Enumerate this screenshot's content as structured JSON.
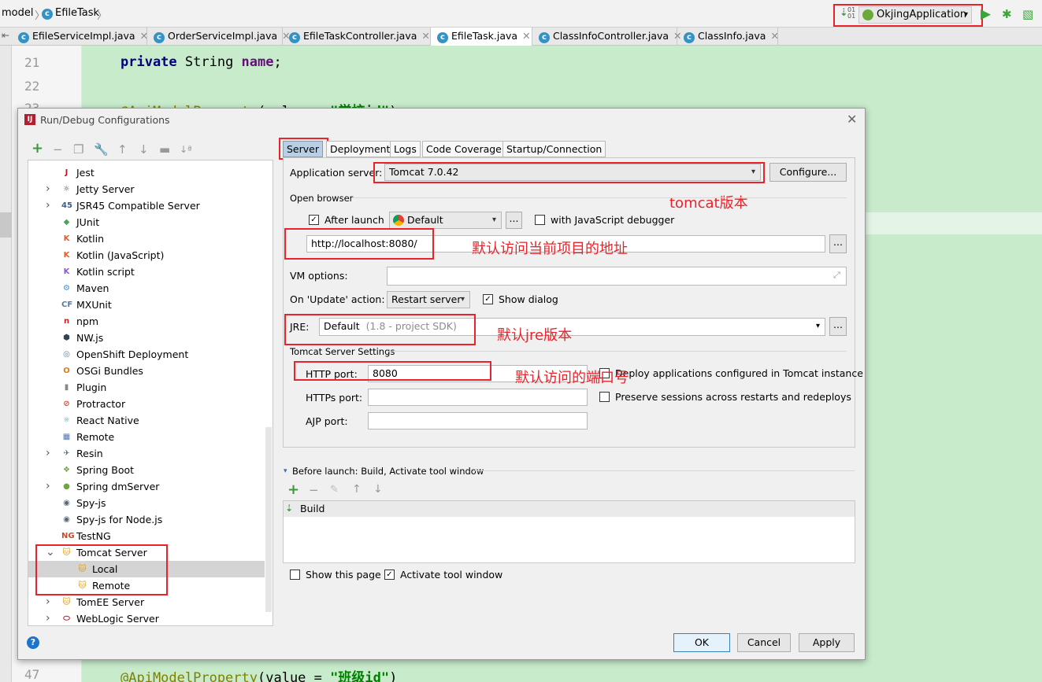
{
  "breadcrumb": {
    "segment1": "model",
    "segment2": "EfileTask",
    "sep": "〉"
  },
  "run_config": {
    "label": "OkjingApplication"
  },
  "tabs": [
    {
      "label": "EfileServiceImpl.java"
    },
    {
      "label": "OrderServiceImpl.java"
    },
    {
      "label": "EfileTaskController.java"
    },
    {
      "label": "EfileTask.java"
    },
    {
      "label": "ClassInfoController.java"
    },
    {
      "label": "ClassInfo.java"
    }
  ],
  "editor": {
    "line21": "21",
    "line22": "22",
    "line23": "23",
    "line47": "47",
    "code21_kw": "private",
    "code21_type": " String ",
    "code21_field": "name",
    "code21_end": ";",
    "code23_ann": "@ApiModelProperty",
    "code23_mid": "(value = ",
    "code23_str": "\"学校id\"",
    "code23_end": ")",
    "code47_ann": "@ApiModelProperty",
    "code47_mid": "(value = ",
    "code47_str": "\"班级id\"",
    "code47_end": ")"
  },
  "dialog": {
    "title": "Run/Debug Configurations",
    "tree": [
      {
        "label": "Jest",
        "arrow": "",
        "indent": 0,
        "icon": "J",
        "color": "#c21325"
      },
      {
        "label": "Jetty Server",
        "arrow": ">",
        "indent": 0,
        "icon": "☼",
        "color": "#555555"
      },
      {
        "label": "JSR45 Compatible Server",
        "arrow": ">",
        "indent": 0,
        "icon": "45",
        "color": "#3a5f8a"
      },
      {
        "label": "JUnit",
        "arrow": "",
        "indent": 0,
        "icon": "◆",
        "color": "#4aa35a"
      },
      {
        "label": "Kotlin",
        "arrow": "",
        "indent": 0,
        "icon": "K",
        "color": "#e05e2e"
      },
      {
        "label": "Kotlin (JavaScript)",
        "arrow": "",
        "indent": 0,
        "icon": "K",
        "color": "#e05e2e"
      },
      {
        "label": "Kotlin script",
        "arrow": "",
        "indent": 0,
        "icon": "K",
        "color": "#8c5ad6"
      },
      {
        "label": "Maven",
        "arrow": "",
        "indent": 0,
        "icon": "⚙",
        "color": "#4a90c8"
      },
      {
        "label": "MXUnit",
        "arrow": "",
        "indent": 0,
        "icon": "CF",
        "color": "#5a7a9a"
      },
      {
        "label": "npm",
        "arrow": "",
        "indent": 0,
        "icon": "n",
        "color": "#c12127"
      },
      {
        "label": "NW.js",
        "arrow": "",
        "indent": 0,
        "icon": "⬢",
        "color": "#334455"
      },
      {
        "label": "OpenShift Deployment",
        "arrow": "",
        "indent": 0,
        "icon": "◎",
        "color": "#3a8fc7"
      },
      {
        "label": "OSGi Bundles",
        "arrow": "",
        "indent": 0,
        "icon": "O",
        "color": "#e07b1a"
      },
      {
        "label": "Plugin",
        "arrow": "",
        "indent": 0,
        "icon": "▮",
        "color": "#888888"
      },
      {
        "label": "Protractor",
        "arrow": "",
        "indent": 0,
        "icon": "⊘",
        "color": "#d24a3a"
      },
      {
        "label": "React Native",
        "arrow": "",
        "indent": 0,
        "icon": "⚛",
        "color": "#3aa8d8"
      },
      {
        "label": "Remote",
        "arrow": "",
        "indent": 0,
        "icon": "▦",
        "color": "#5577aa"
      },
      {
        "label": "Resin",
        "arrow": ">",
        "indent": 0,
        "icon": "✈",
        "color": "#4477aa"
      },
      {
        "label": "Spring Boot",
        "arrow": "",
        "indent": 0,
        "icon": "❖",
        "color": "#6aaa3a"
      },
      {
        "label": "Spring dmServer",
        "arrow": ">",
        "indent": 0,
        "icon": "●",
        "color": "#6aaa3a"
      },
      {
        "label": "Spy-js",
        "arrow": "",
        "indent": 0,
        "icon": "◉",
        "color": "#556677"
      },
      {
        "label": "Spy-js for Node.js",
        "arrow": "",
        "indent": 0,
        "icon": "◉",
        "color": "#556677"
      },
      {
        "label": "TestNG",
        "arrow": "",
        "indent": 0,
        "icon": "NG",
        "color": "#c84a2a"
      },
      {
        "label": "Tomcat Server",
        "arrow": "v",
        "indent": 0,
        "icon": "🐱",
        "color": "#d8a020"
      },
      {
        "label": "Local",
        "arrow": "",
        "indent": 1,
        "icon": "🐱",
        "color": "#d8a020",
        "selected": true
      },
      {
        "label": "Remote",
        "arrow": "",
        "indent": 1,
        "icon": "🐱",
        "color": "#d8a020"
      },
      {
        "label": "TomEE Server",
        "arrow": ">",
        "indent": 0,
        "icon": "🐱",
        "color": "#d8a020"
      },
      {
        "label": "WebLogic Server",
        "arrow": ">",
        "indent": 0,
        "icon": "⬭",
        "color": "#c8102e"
      }
    ],
    "config_tabs": [
      "Server",
      "Deployment",
      "Logs",
      "Code Coverage",
      "Startup/Connection"
    ],
    "app_server_label": "Application server:",
    "app_server_value": "Tomcat 7.0.42",
    "configure_btn": "Configure...",
    "open_browser_label": "Open browser",
    "after_launch_label": "After launch",
    "browser_value": "Default",
    "ellipsis": "...",
    "js_debugger_label": "with JavaScript debugger",
    "url_value": "http://localhost:8080/",
    "vm_options_label": "VM options:",
    "on_update_label": "On 'Update' action:",
    "on_update_value": "Restart server",
    "show_dialog_label": "Show dialog",
    "jre_label": "JRE:",
    "jre_value": "Default",
    "jre_hint": "(1.8 - project SDK)",
    "tomcat_settings_label": "Tomcat Server Settings",
    "http_port_label": "HTTP port:",
    "http_port_value": "8080",
    "https_port_label": "HTTPs port:",
    "ajp_port_label": "AJP port:",
    "deploy_apps_label": "Deploy applications configured in Tomcat instance",
    "preserve_sessions_label": "Preserve sessions across restarts and redeploys",
    "before_launch_label": "Before launch: Build, Activate tool window",
    "build_item": "Build",
    "show_page_label": "Show this page",
    "activate_window_label": "Activate tool window",
    "ok_btn": "OK",
    "cancel_btn": "Cancel",
    "apply_btn": "Apply",
    "help": "?"
  },
  "annotations": {
    "tomcat_version": "tomcat版本",
    "default_url": "默认访问当前项目的地址",
    "jre_version": "默认jre版本",
    "default_port": "默认访问的端口号"
  },
  "colors": {
    "annotation_red": "#e8232a",
    "editor_bg": "#c7ebcb",
    "selected_tab": "#b8cfe5"
  }
}
